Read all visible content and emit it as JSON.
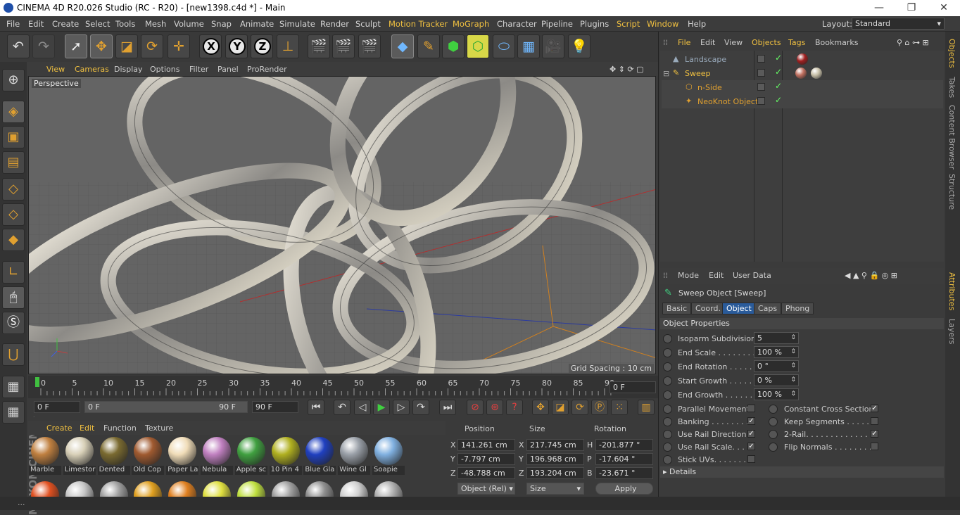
{
  "window": {
    "title": "CINEMA 4D R20.026 Studio (RC - R20) - [new1398.c4d *] - Main",
    "minimize": "—",
    "restore": "❐",
    "close": "✕"
  },
  "menu": [
    "File",
    "Edit",
    "Create",
    "Select",
    "Tools",
    "Mesh",
    "Volume",
    "Snap",
    "Animate",
    "Simulate",
    "Render",
    "Sculpt",
    "Motion Tracker",
    "MoGraph",
    "Character",
    "Pipeline",
    "Plugins",
    "Script",
    "Window",
    "Help"
  ],
  "layout": {
    "label": "Layout:",
    "value": "Standard"
  },
  "viewport": {
    "menu": [
      "View",
      "Cameras",
      "Display",
      "Options",
      "Filter",
      "Panel",
      "ProRender"
    ],
    "label": "Perspective",
    "grid_spacing": "Grid Spacing : 10 cm"
  },
  "timeline": {
    "ticks": [
      "0",
      "5",
      "10",
      "15",
      "20",
      "25",
      "30",
      "35",
      "40",
      "45",
      "50",
      "55",
      "60",
      "65",
      "70",
      "75",
      "80",
      "85",
      "90"
    ],
    "current_frame": "0 F",
    "start": "0 F",
    "range_start": "0 F",
    "range_end": "90 F",
    "end": "90 F"
  },
  "materials": {
    "menu": [
      "Create",
      "Edit",
      "Function",
      "Texture"
    ],
    "items": [
      {
        "name": "Marble",
        "color": "#c08040"
      },
      {
        "name": "Limestor",
        "color": "#d8d0b8"
      },
      {
        "name": "Dented",
        "color": "#7a6a30"
      },
      {
        "name": "Old Cop",
        "color": "#a05a30"
      },
      {
        "name": "Paper La",
        "color": "#f0dcb8"
      },
      {
        "name": "Nebula",
        "color": "#c080c0"
      },
      {
        "name": "Apple sc",
        "color": "#40a040"
      },
      {
        "name": "10 Pin 4",
        "color": "#b0b020"
      },
      {
        "name": "Blue Gla",
        "color": "#2040c0"
      },
      {
        "name": "Wine Gl",
        "color": "#9aa0a8"
      },
      {
        "name": "Soapie",
        "color": "#80b0e0"
      }
    ],
    "row2_colors": [
      "#e05020",
      "#c8c8c8",
      "#a0a0a0",
      "#e0a020",
      "#e08020",
      "#e0e040",
      "#c0e040",
      "#a0a0a0",
      "#909090",
      "#d0d0d0",
      "#b0b0b0"
    ]
  },
  "coords": {
    "headers": [
      "Position",
      "Size",
      "Rotation"
    ],
    "rows": [
      {
        "axis": "X",
        "pos": "141.261 cm",
        "saxis": "X",
        "size": "217.745 cm",
        "raxis": "H",
        "rot": "-201.877 °"
      },
      {
        "axis": "Y",
        "pos": "-7.797 cm",
        "saxis": "Y",
        "size": "196.968 cm",
        "raxis": "P",
        "rot": "-17.604 °"
      },
      {
        "axis": "Z",
        "pos": "-48.788 cm",
        "saxis": "Z",
        "size": "193.204 cm",
        "raxis": "B",
        "rot": "-23.671 °"
      }
    ],
    "mode": "Object (Rel)",
    "size_mode": "Size",
    "apply": "Apply"
  },
  "objects": {
    "menu": [
      "File",
      "Edit",
      "View",
      "Objects",
      "Tags",
      "Bookmarks"
    ],
    "items": [
      {
        "name": "Landscape",
        "color": "#9ab"
      },
      {
        "name": "Sweep",
        "color": "#f0c040"
      },
      {
        "name": "n-Side",
        "color": "#e0a030"
      },
      {
        "name": "NeoKnot Object",
        "color": "#e0a030"
      }
    ]
  },
  "sidetabs": [
    "Objects",
    "Takes",
    "Content Browser",
    "Structure",
    "Attributes",
    "Layers"
  ],
  "attributes": {
    "menu": [
      "Mode",
      "Edit",
      "User Data"
    ],
    "title": "Sweep Object [Sweep]",
    "tabs": [
      "Basic",
      "Coord.",
      "Object",
      "Caps",
      "Phong"
    ],
    "section": "Object Properties",
    "fields": [
      {
        "label": "Isoparm Subdivision",
        "value": "5"
      },
      {
        "label": "End Scale . . . . . . . . .",
        "value": "100 %"
      },
      {
        "label": "End Rotation . . . . . .",
        "value": "0 °"
      },
      {
        "label": "Start Growth . . . . . .",
        "value": "0 %"
      },
      {
        "label": "End Growth . . . . . . .",
        "value": "100 %"
      }
    ],
    "checks_left": [
      {
        "label": "Parallel Movement",
        "checked": false
      },
      {
        "label": "Banking . . . . . . . . .",
        "checked": true
      },
      {
        "label": "Use Rail Direction",
        "checked": true
      },
      {
        "label": "Use Rail Scale. . . .",
        "checked": true
      },
      {
        "label": "Stick UVs. . . . . . . .",
        "checked": false
      }
    ],
    "checks_right": [
      {
        "label": "Constant Cross Section",
        "checked": true
      },
      {
        "label": "Keep Segments . . . . . . .",
        "checked": false
      },
      {
        "label": "2-Rail. . . . . . . . . . . . . . .",
        "checked": true
      },
      {
        "label": "Flip Normals . . . . . . . . .",
        "checked": false
      }
    ],
    "details": "Details"
  },
  "brand": "MAXON CINEMA 4D",
  "status": "..."
}
